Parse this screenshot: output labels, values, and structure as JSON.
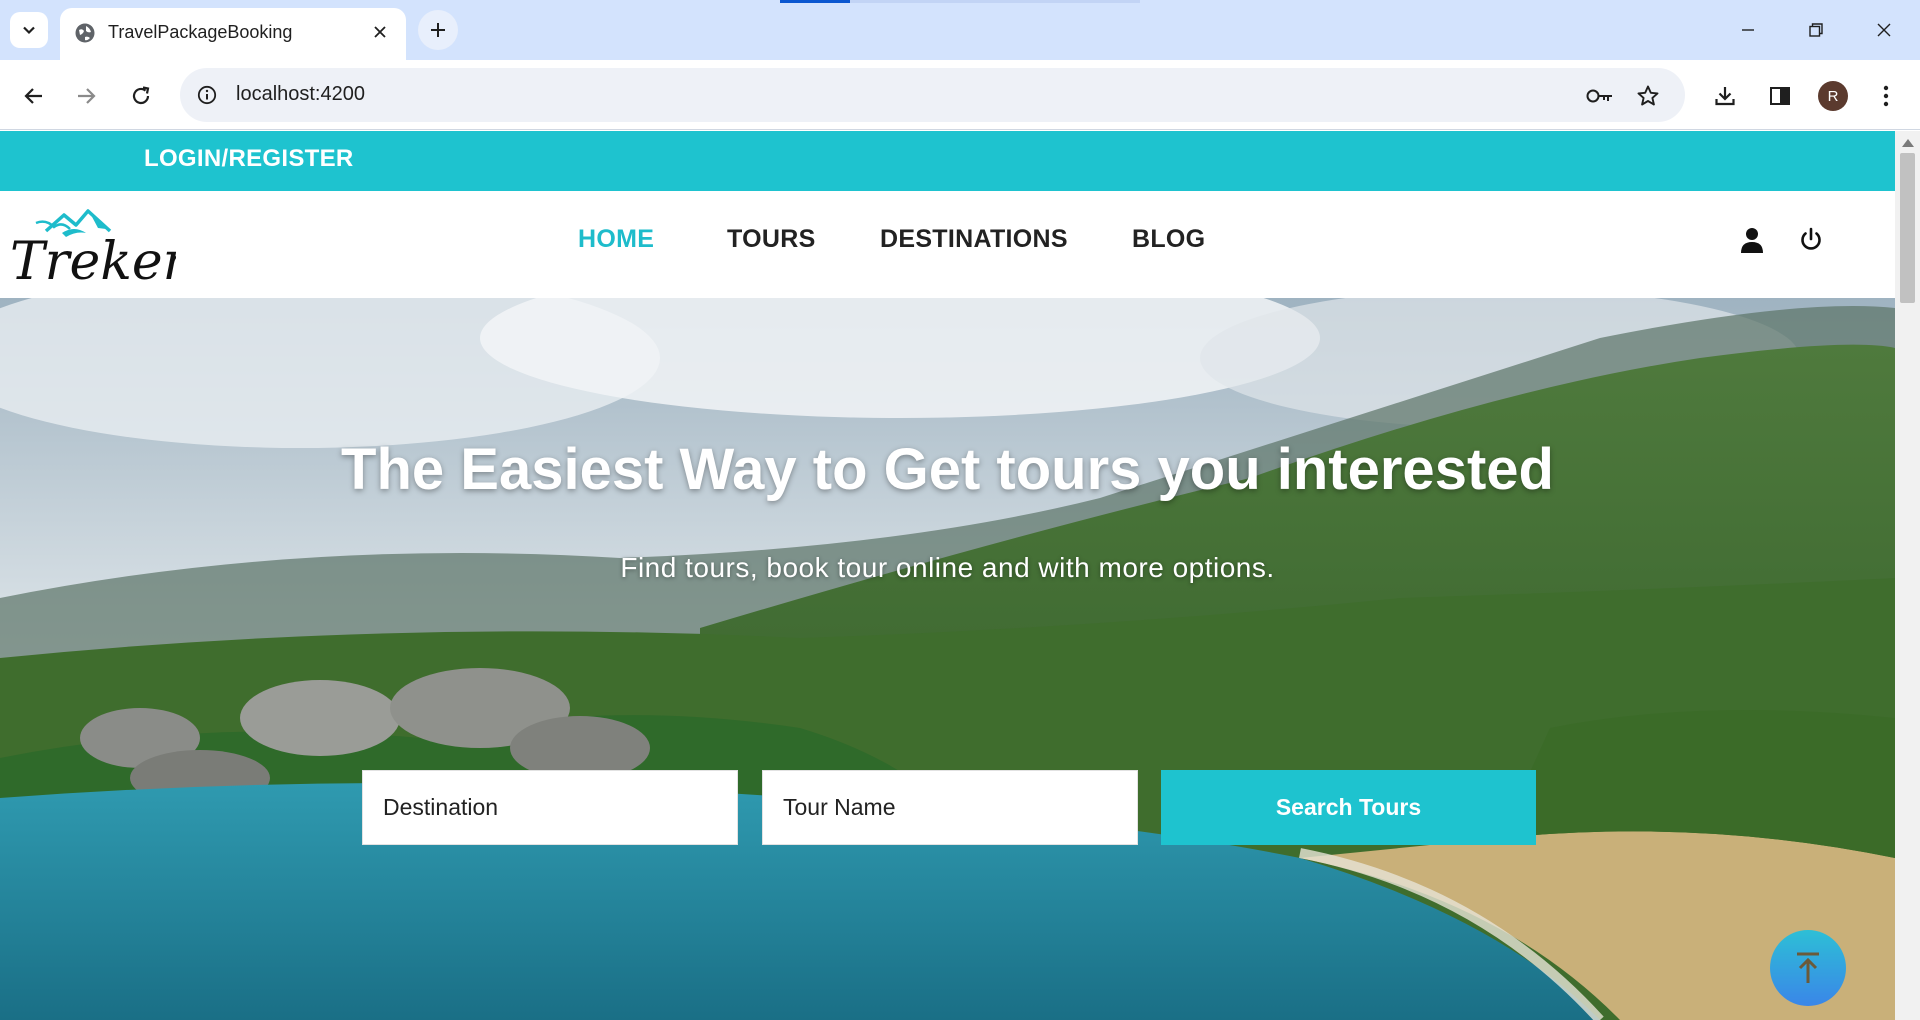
{
  "browser": {
    "tab_title": "TravelPackageBooking",
    "url": "localhost:4200",
    "profile_initial": "R"
  },
  "topbar": {
    "login_label": "LOGIN/REGISTER"
  },
  "navbar": {
    "logo_text": "Treker",
    "items": [
      {
        "label": "HOME",
        "active": true
      },
      {
        "label": "TOURS",
        "active": false
      },
      {
        "label": "DESTINATIONS",
        "active": false
      },
      {
        "label": "BLOG",
        "active": false
      }
    ],
    "icons": [
      "user-icon",
      "power-icon"
    ]
  },
  "hero": {
    "title": "The Easiest Way to Get tours you interested",
    "subtitle": "Find tours, book tour online and with more options.",
    "search": {
      "destination_placeholder": "Destination",
      "tour_name_placeholder": "Tour Name",
      "button_label": "Search Tours"
    }
  },
  "colors": {
    "accent": "#1ec3cf",
    "active_nav": "#1ebccb",
    "browser_tabstrip": "#d3e3fd"
  }
}
